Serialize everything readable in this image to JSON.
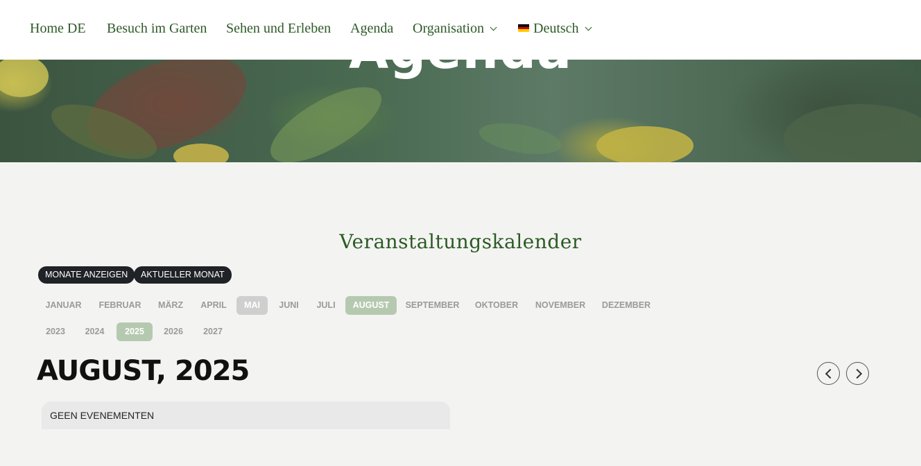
{
  "nav": {
    "items": [
      {
        "label": "Home DE"
      },
      {
        "label": "Besuch im Garten"
      },
      {
        "label": "Sehen und Erleben"
      },
      {
        "label": "Agenda"
      },
      {
        "label": "Organisation"
      },
      {
        "label": "Deutsch"
      }
    ],
    "flag_icon": "german-flag-icon"
  },
  "hero": {
    "title": "Agenda"
  },
  "calendar": {
    "title": "Veranstaltungskalender",
    "buttons": {
      "show_months": "MONATE ANZEIGEN",
      "current_month": "AKTUELLER MONAT"
    },
    "months": [
      "JANUAR",
      "FEBRUAR",
      "MÄRZ",
      "APRIL",
      "MAI",
      "JUNI",
      "JULI",
      "AUGUST",
      "SEPTEMBER",
      "OKTOBER",
      "NOVEMBER",
      "DEZEMBER"
    ],
    "highlighted_month": "MAI",
    "selected_month": "AUGUST",
    "years": [
      "2023",
      "2024",
      "2025",
      "2026",
      "2027"
    ],
    "selected_year": "2025",
    "heading": "AUGUST, 2025",
    "empty_message": "GEEN EVENEMENTEN",
    "colors": {
      "accent": "#2d5a27",
      "selected": "#b5c9b0",
      "highlight": "#cfcfcf",
      "button_bg": "#1f2226"
    }
  }
}
